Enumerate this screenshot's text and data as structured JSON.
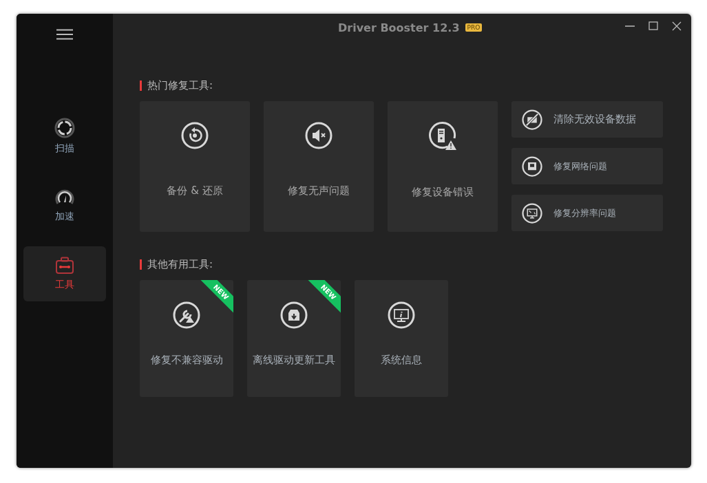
{
  "window": {
    "title": "Driver Booster 12.3",
    "edition_badge": "PRO"
  },
  "sidebar": {
    "items": [
      {
        "label": "扫描",
        "selected": false
      },
      {
        "label": "加速",
        "selected": false
      },
      {
        "label": "工具",
        "selected": true
      }
    ]
  },
  "hot_tools": {
    "heading": "热门修复工具:",
    "large": [
      {
        "label": "备份 & 还原"
      },
      {
        "label": "修复无声问题"
      },
      {
        "label": "修复设备错误"
      }
    ],
    "small": [
      {
        "label": "清除无效设备数据"
      },
      {
        "label": "修复网络问题"
      },
      {
        "label": "修复分辨率问题"
      }
    ]
  },
  "other_tools": {
    "heading": "其他有用工具:",
    "items": [
      {
        "label": "修复不兼容驱动",
        "badge": "NEW"
      },
      {
        "label": "离线驱动更新工具",
        "badge": "NEW"
      },
      {
        "label": "系统信息"
      }
    ]
  }
}
